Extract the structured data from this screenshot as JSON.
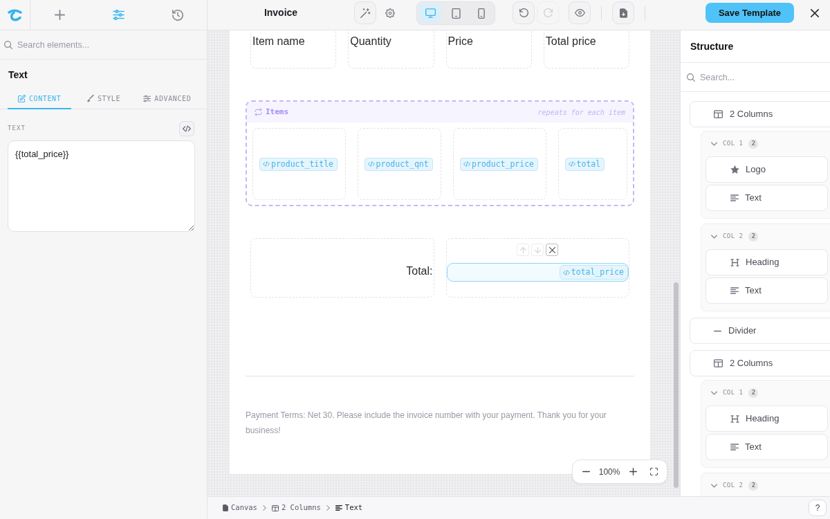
{
  "left_toolbar": [
    {
      "kind": "add",
      "selected": false
    },
    {
      "kind": "properties",
      "selected": true
    },
    {
      "kind": "history",
      "selected": false
    }
  ],
  "element_search": {
    "placeholder": "Search elements..."
  },
  "inspector": {
    "title": "Text",
    "tabs": [
      {
        "kind": "content",
        "label": "CONTENT",
        "selected": true
      },
      {
        "kind": "style",
        "label": "STYLE",
        "selected": false
      },
      {
        "kind": "advanced",
        "label": "ADVANCED",
        "selected": false
      }
    ],
    "field": {
      "label": "TEXT",
      "value": "{{total_price}}"
    }
  },
  "toolbar": {
    "title": "Invoice",
    "devices": [
      {
        "kind": "desktop",
        "selected": true
      },
      {
        "kind": "tablet",
        "selected": false
      },
      {
        "kind": "mobile",
        "selected": false
      }
    ],
    "history_buttons": [
      {
        "kind": "undo",
        "disabled": false
      },
      {
        "kind": "redo",
        "disabled": true
      }
    ],
    "save_button": "Save Template"
  },
  "canvas": {
    "header_row": [
      "Item name",
      "Quantity",
      "Price",
      "Total price"
    ],
    "repeater": {
      "title": "Items",
      "note": "repeats for each item",
      "variables": [
        "product_title",
        "product_qnt",
        "product_price",
        "total"
      ]
    },
    "total_row": {
      "label": "Total:",
      "variable": "total_price",
      "selected": true,
      "controls": [
        {
          "kind": "up",
          "disabled": true
        },
        {
          "kind": "down",
          "disabled": true
        },
        {
          "kind": "delete",
          "disabled": false
        }
      ]
    },
    "footer_text": "Payment Terms: Net 30. Please include the invoice number with your payment. Thank you for your business!"
  },
  "zoom": "100%",
  "structure": {
    "title": "Structure",
    "search": {
      "placeholder": "Search..."
    },
    "tree": [
      {
        "kind": "columns",
        "label": "2 Columns",
        "children": [
          {
            "kind": "column",
            "label": "COL 1",
            "count": "2",
            "expanded": true,
            "children": [
              {
                "kind": "logo",
                "label": "Logo"
              },
              {
                "kind": "text",
                "label": "Text"
              }
            ]
          },
          {
            "kind": "column",
            "label": "COL 2",
            "count": "2",
            "expanded": true,
            "children": [
              {
                "kind": "heading",
                "label": "Heading"
              },
              {
                "kind": "text",
                "label": "Text"
              }
            ]
          }
        ]
      },
      {
        "kind": "divider",
        "label": "Divider"
      },
      {
        "kind": "columns",
        "label": "2 Columns",
        "children": [
          {
            "kind": "column",
            "label": "COL 1",
            "count": "2",
            "expanded": true,
            "children": [
              {
                "kind": "heading",
                "label": "Heading"
              },
              {
                "kind": "text",
                "label": "Text"
              }
            ]
          },
          {
            "kind": "column",
            "label": "COL 2",
            "count": "2",
            "expanded": true
          }
        ]
      }
    ]
  },
  "breadcrumb": [
    {
      "kind": "canvas",
      "label": "Canvas"
    },
    {
      "kind": "columns",
      "label": "2 Columns"
    },
    {
      "kind": "text",
      "label": "Text"
    }
  ],
  "help_button": "?"
}
